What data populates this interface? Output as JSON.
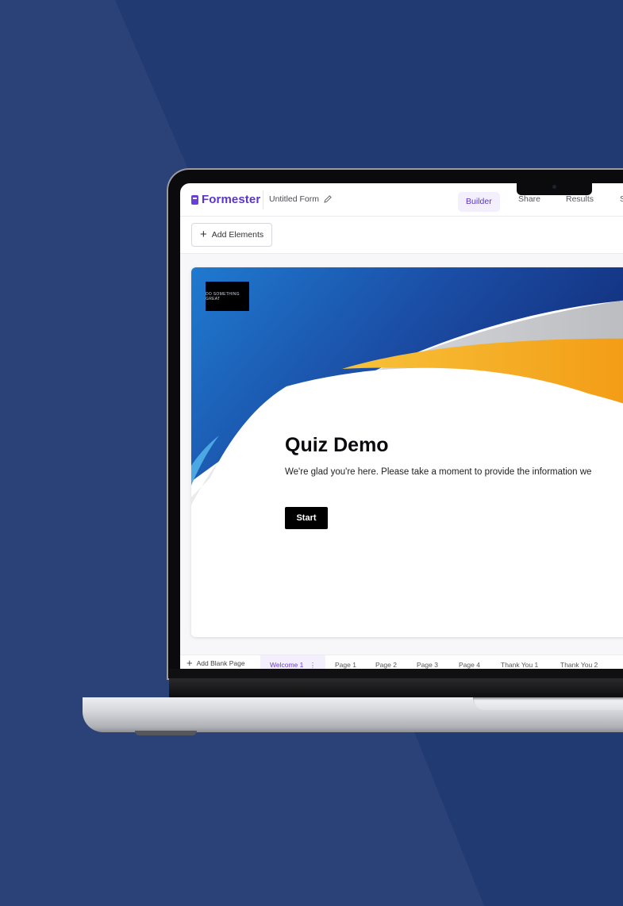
{
  "app": {
    "brand": "Formester",
    "form_title": "Untitled Form",
    "nav_tabs": [
      {
        "label": "Builder",
        "active": true
      },
      {
        "label": "Share",
        "active": false
      },
      {
        "label": "Results",
        "active": false
      },
      {
        "label": "S",
        "active": false
      }
    ],
    "toolbar": {
      "add_elements_label": "Add Elements"
    }
  },
  "form": {
    "logo_text": "DO SOMETHING GREAT",
    "title": "Quiz Demo",
    "description": "We're glad you're here. Please take a moment to provide the information we",
    "start_label": "Start"
  },
  "pages_bar": {
    "add_label": "Add Blank Page",
    "tabs": [
      {
        "label": "Welcome 1",
        "active": true
      },
      {
        "label": "Page 1",
        "active": false
      },
      {
        "label": "Page 2",
        "active": false
      },
      {
        "label": "Page 3",
        "active": false
      },
      {
        "label": "Page 4",
        "active": false
      },
      {
        "label": "Thank You 1",
        "active": false
      },
      {
        "label": "Thank You 2",
        "active": false
      }
    ]
  },
  "colors": {
    "background": "#213a72",
    "brand_purple": "#5b34c9",
    "active_tab_bg": "#f3effc"
  }
}
